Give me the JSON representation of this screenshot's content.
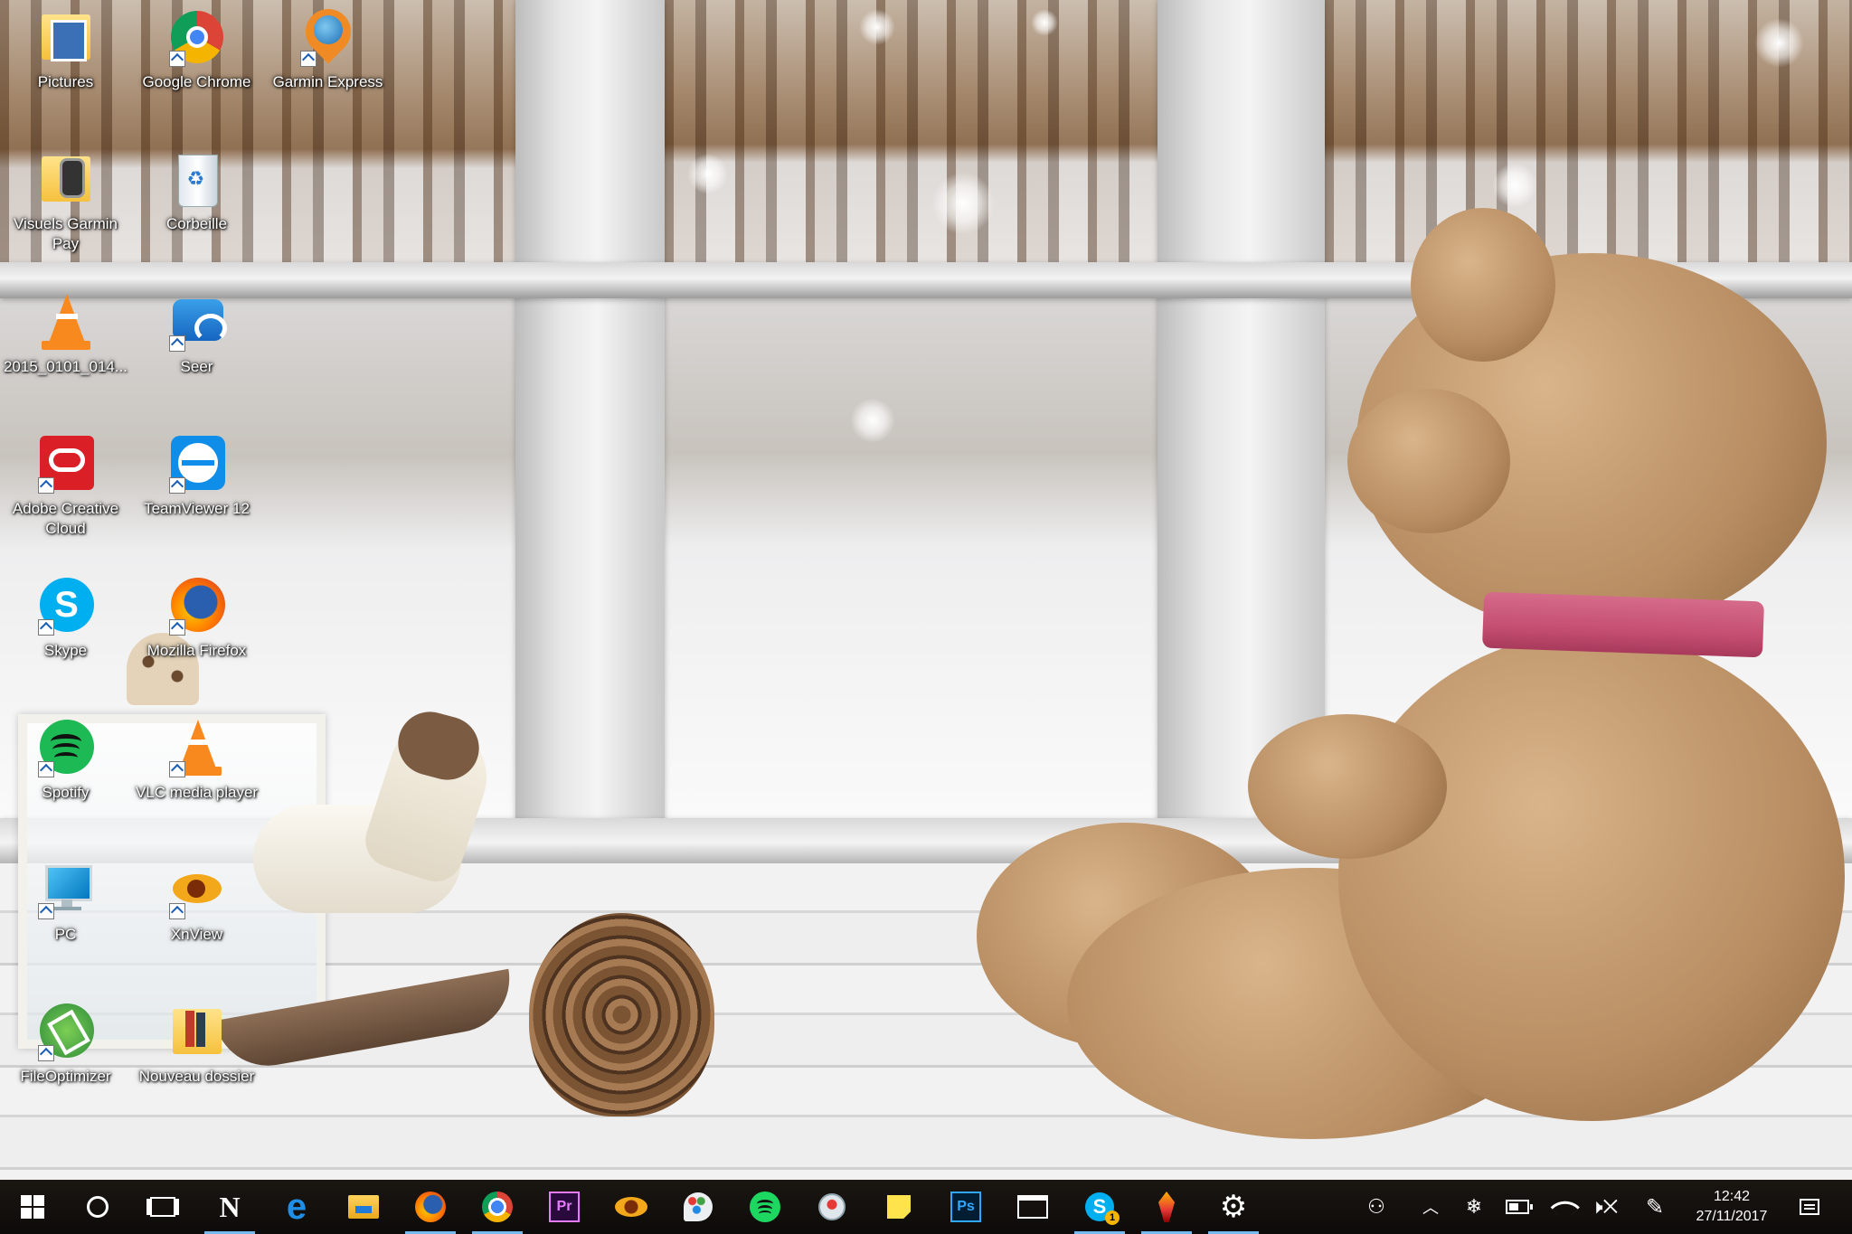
{
  "desktop": {
    "icons": [
      {
        "label": "Pictures"
      },
      {
        "label": "Google Chrome"
      },
      {
        "label": "Garmin Express"
      },
      {
        "label": "Visuels Garmin Pay"
      },
      {
        "label": "Corbeille"
      },
      {
        "label": "2015_0101_014..."
      },
      {
        "label": "Seer"
      },
      {
        "label": "Adobe Creative Cloud"
      },
      {
        "label": "TeamViewer 12"
      },
      {
        "label": "Skype"
      },
      {
        "label": "Mozilla Firefox"
      },
      {
        "label": "Spotify"
      },
      {
        "label": "VLC media player"
      },
      {
        "label": "PC"
      },
      {
        "label": "XnView"
      },
      {
        "label": "FileOptimizer"
      },
      {
        "label": "Nouveau dossier"
      }
    ]
  },
  "taskbar": {
    "start_icon": "windows-logo-icon",
    "search_icon": "cortana-circle-icon",
    "taskview_icon": "task-view-icon",
    "apps": [
      {
        "icon": "onenote-n-icon",
        "text": "N"
      },
      {
        "icon": "edge-icon",
        "text": "e"
      },
      {
        "icon": "file-explorer-icon"
      },
      {
        "icon": "firefox-icon"
      },
      {
        "icon": "chrome-icon"
      },
      {
        "icon": "premiere-icon",
        "text": "Pr"
      },
      {
        "icon": "xnview-icon"
      },
      {
        "icon": "paint-icon"
      },
      {
        "icon": "spotify-icon"
      },
      {
        "icon": "snipping-icon"
      },
      {
        "icon": "sticky-notes-icon"
      },
      {
        "icon": "photoshop-icon",
        "text": "Ps"
      },
      {
        "icon": "window-icon"
      },
      {
        "icon": "skype-icon",
        "text": "S",
        "badge": "1"
      },
      {
        "icon": "pen-app-icon"
      },
      {
        "icon": "settings-gear-icon"
      }
    ],
    "tray": [
      {
        "icon": "people-icon"
      },
      {
        "icon": "chevron-up-icon"
      },
      {
        "icon": "snowflake-icon"
      },
      {
        "icon": "battery-icon"
      },
      {
        "icon": "wifi-icon"
      },
      {
        "icon": "volume-muted-icon"
      },
      {
        "icon": "pen-ink-icon"
      }
    ],
    "clock": {
      "time": "12:42",
      "date": "27/11/2017"
    },
    "notifications_icon": "action-center-icon"
  },
  "colors": {
    "taskbar_accent": "#76b9ed",
    "premiere": "#2a0a3d",
    "photoshop": "#001d34",
    "spotify": "#1ed760"
  }
}
